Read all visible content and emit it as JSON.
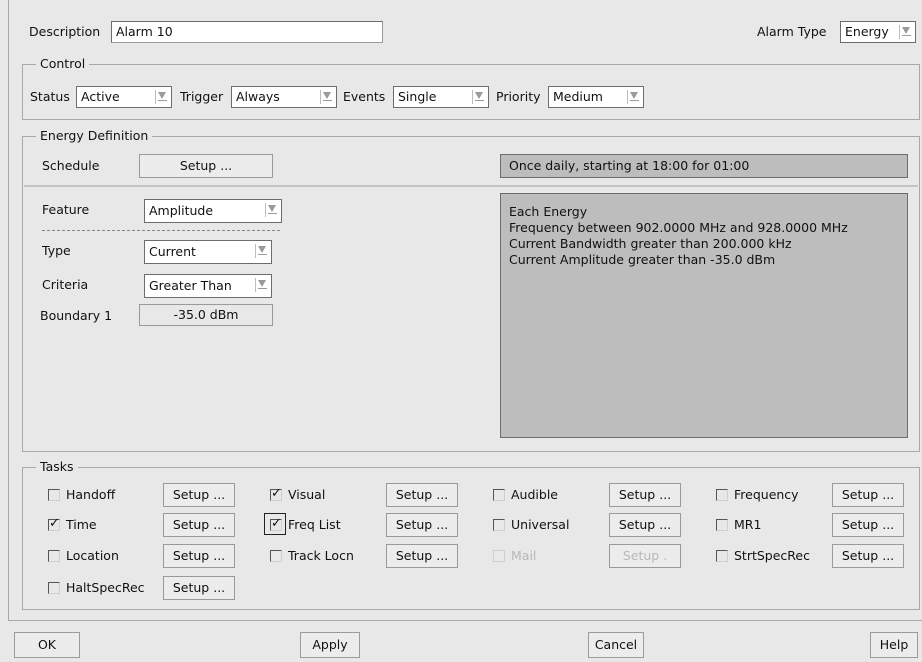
{
  "header": {
    "description_label": "Description",
    "description_value": "Alarm 10",
    "alarm_type_label": "Alarm Type",
    "alarm_type_value": "Energy"
  },
  "control": {
    "legend": "Control",
    "status_label": "Status",
    "status_value": "Active",
    "trigger_label": "Trigger",
    "trigger_value": "Always",
    "events_label": "Events",
    "events_value": "Single",
    "priority_label": "Priority",
    "priority_value": "Medium"
  },
  "energy": {
    "legend": "Energy Definition",
    "schedule_label": "Schedule",
    "schedule_button": "Setup ...",
    "schedule_summary": "Once daily, starting at 18:00 for 01:00",
    "feature_label": "Feature",
    "feature_value": "Amplitude",
    "type_label": "Type",
    "type_value": "Current",
    "criteria_label": "Criteria",
    "criteria_value": "Greater Than",
    "boundary_label": "Boundary 1",
    "boundary_value": "-35.0 dBm",
    "summary_lines": [
      "Each Energy",
      "Frequency between 902.0000 MHz and 928.0000 MHz",
      "Current Bandwidth greater than 200.000 kHz",
      "Current Amplitude greater than -35.0 dBm"
    ]
  },
  "tasks": {
    "legend": "Tasks",
    "setup_label": "Setup ...",
    "disabled_setup_label": "Setup .",
    "items": [
      {
        "label": "Handoff",
        "checked": false,
        "enabled": true
      },
      {
        "label": "Visual",
        "checked": true,
        "enabled": true
      },
      {
        "label": "Audible",
        "checked": false,
        "enabled": true
      },
      {
        "label": "Frequency",
        "checked": false,
        "enabled": true
      },
      {
        "label": "Time",
        "checked": true,
        "enabled": true
      },
      {
        "label": "Freq List",
        "checked": true,
        "enabled": true
      },
      {
        "label": "Universal",
        "checked": false,
        "enabled": true
      },
      {
        "label": "MR1",
        "checked": false,
        "enabled": true
      },
      {
        "label": "Location",
        "checked": false,
        "enabled": true
      },
      {
        "label": "Track Locn",
        "checked": false,
        "enabled": true
      },
      {
        "label": "Mail",
        "checked": false,
        "enabled": false
      },
      {
        "label": "StrtSpecRec",
        "checked": false,
        "enabled": true
      },
      {
        "label": "HaltSpecRec",
        "checked": false,
        "enabled": true
      }
    ]
  },
  "footer": {
    "ok": "OK",
    "apply": "Apply",
    "cancel": "Cancel",
    "help": "Help"
  }
}
